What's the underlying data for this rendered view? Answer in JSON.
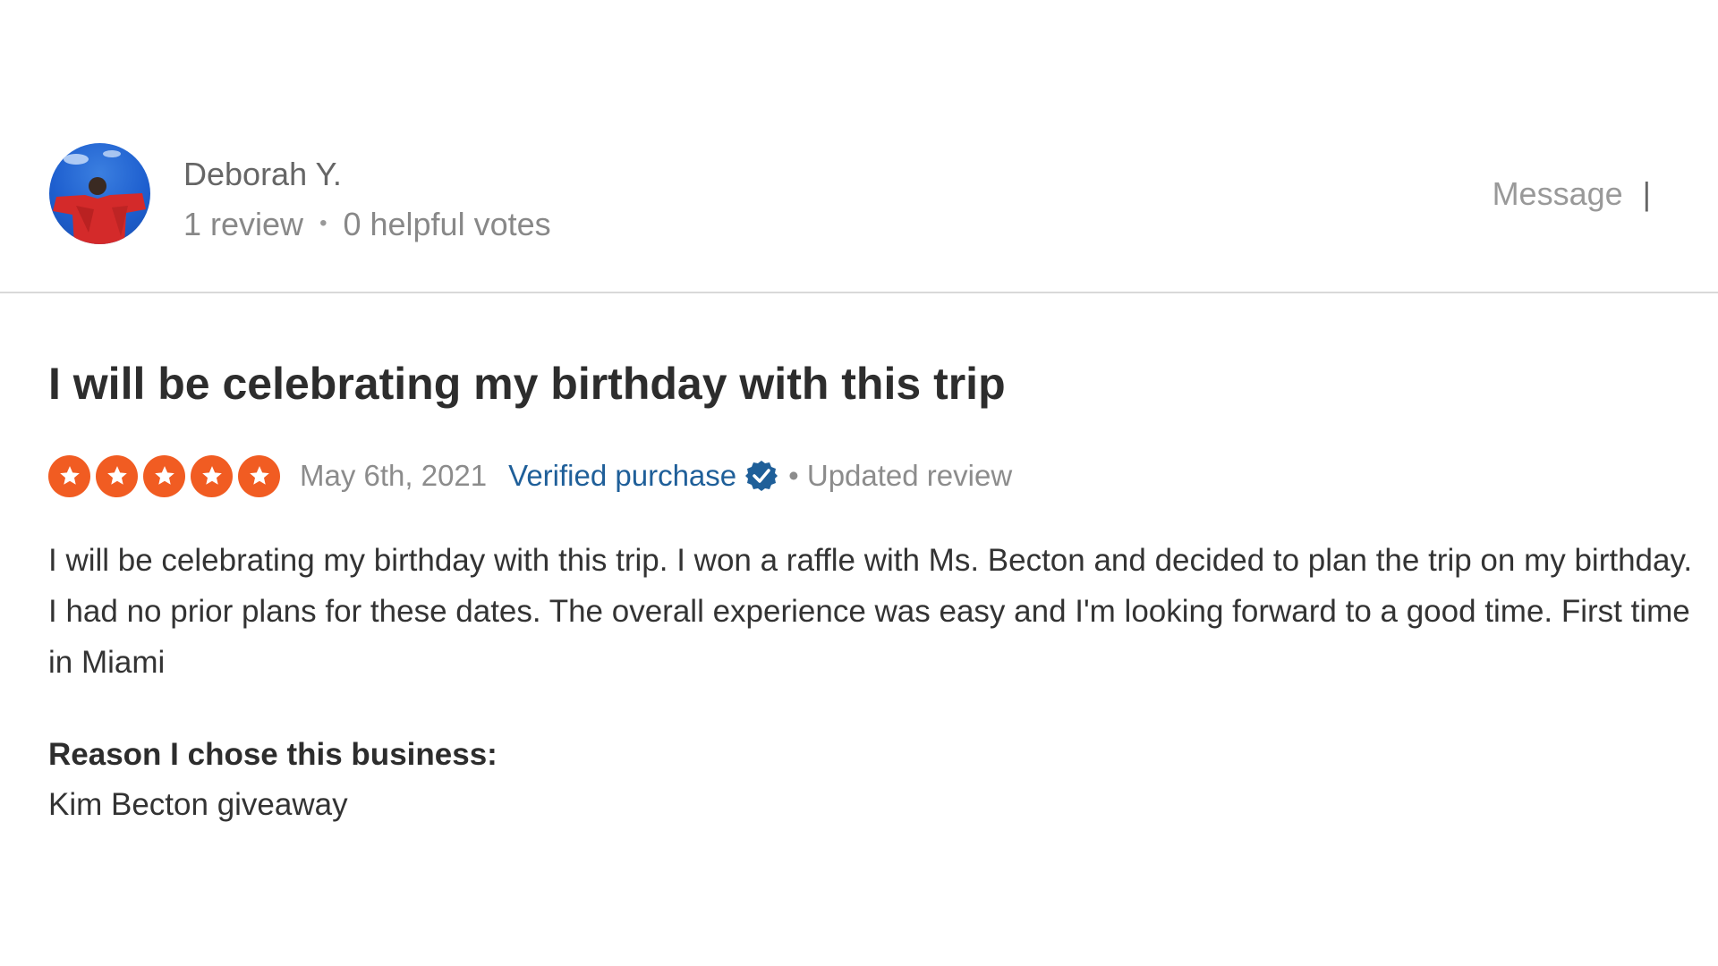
{
  "reviewer": {
    "name": "Deborah Y.",
    "review_count": "1 review",
    "separator": "•",
    "helpful_votes": "0 helpful votes",
    "avatar_icon": "avatar-icon"
  },
  "actions": {
    "message_label": "Message",
    "bar": "|"
  },
  "review": {
    "title": "I will be celebrating my birthday with this trip",
    "rating": 5,
    "rating_max": 5,
    "star_color": "#f15c22",
    "date": "May 6th, 2021",
    "verified_label": "Verified purchase",
    "verified_icon": "check-circle-icon",
    "updated_label": "• Updated review",
    "body": "I will be celebrating my birthday with this trip. I won a raffle with Ms. Becton and decided to plan the trip on my birthday. I had no prior plans for these dates. The overall experience was easy and I'm looking forward to a good time. First time in Miami",
    "reason_label": "Reason I chose this business:",
    "reason_value": "Kim Becton giveaway"
  },
  "colors": {
    "accent_link": "#1f5f99",
    "star": "#f15c22"
  }
}
